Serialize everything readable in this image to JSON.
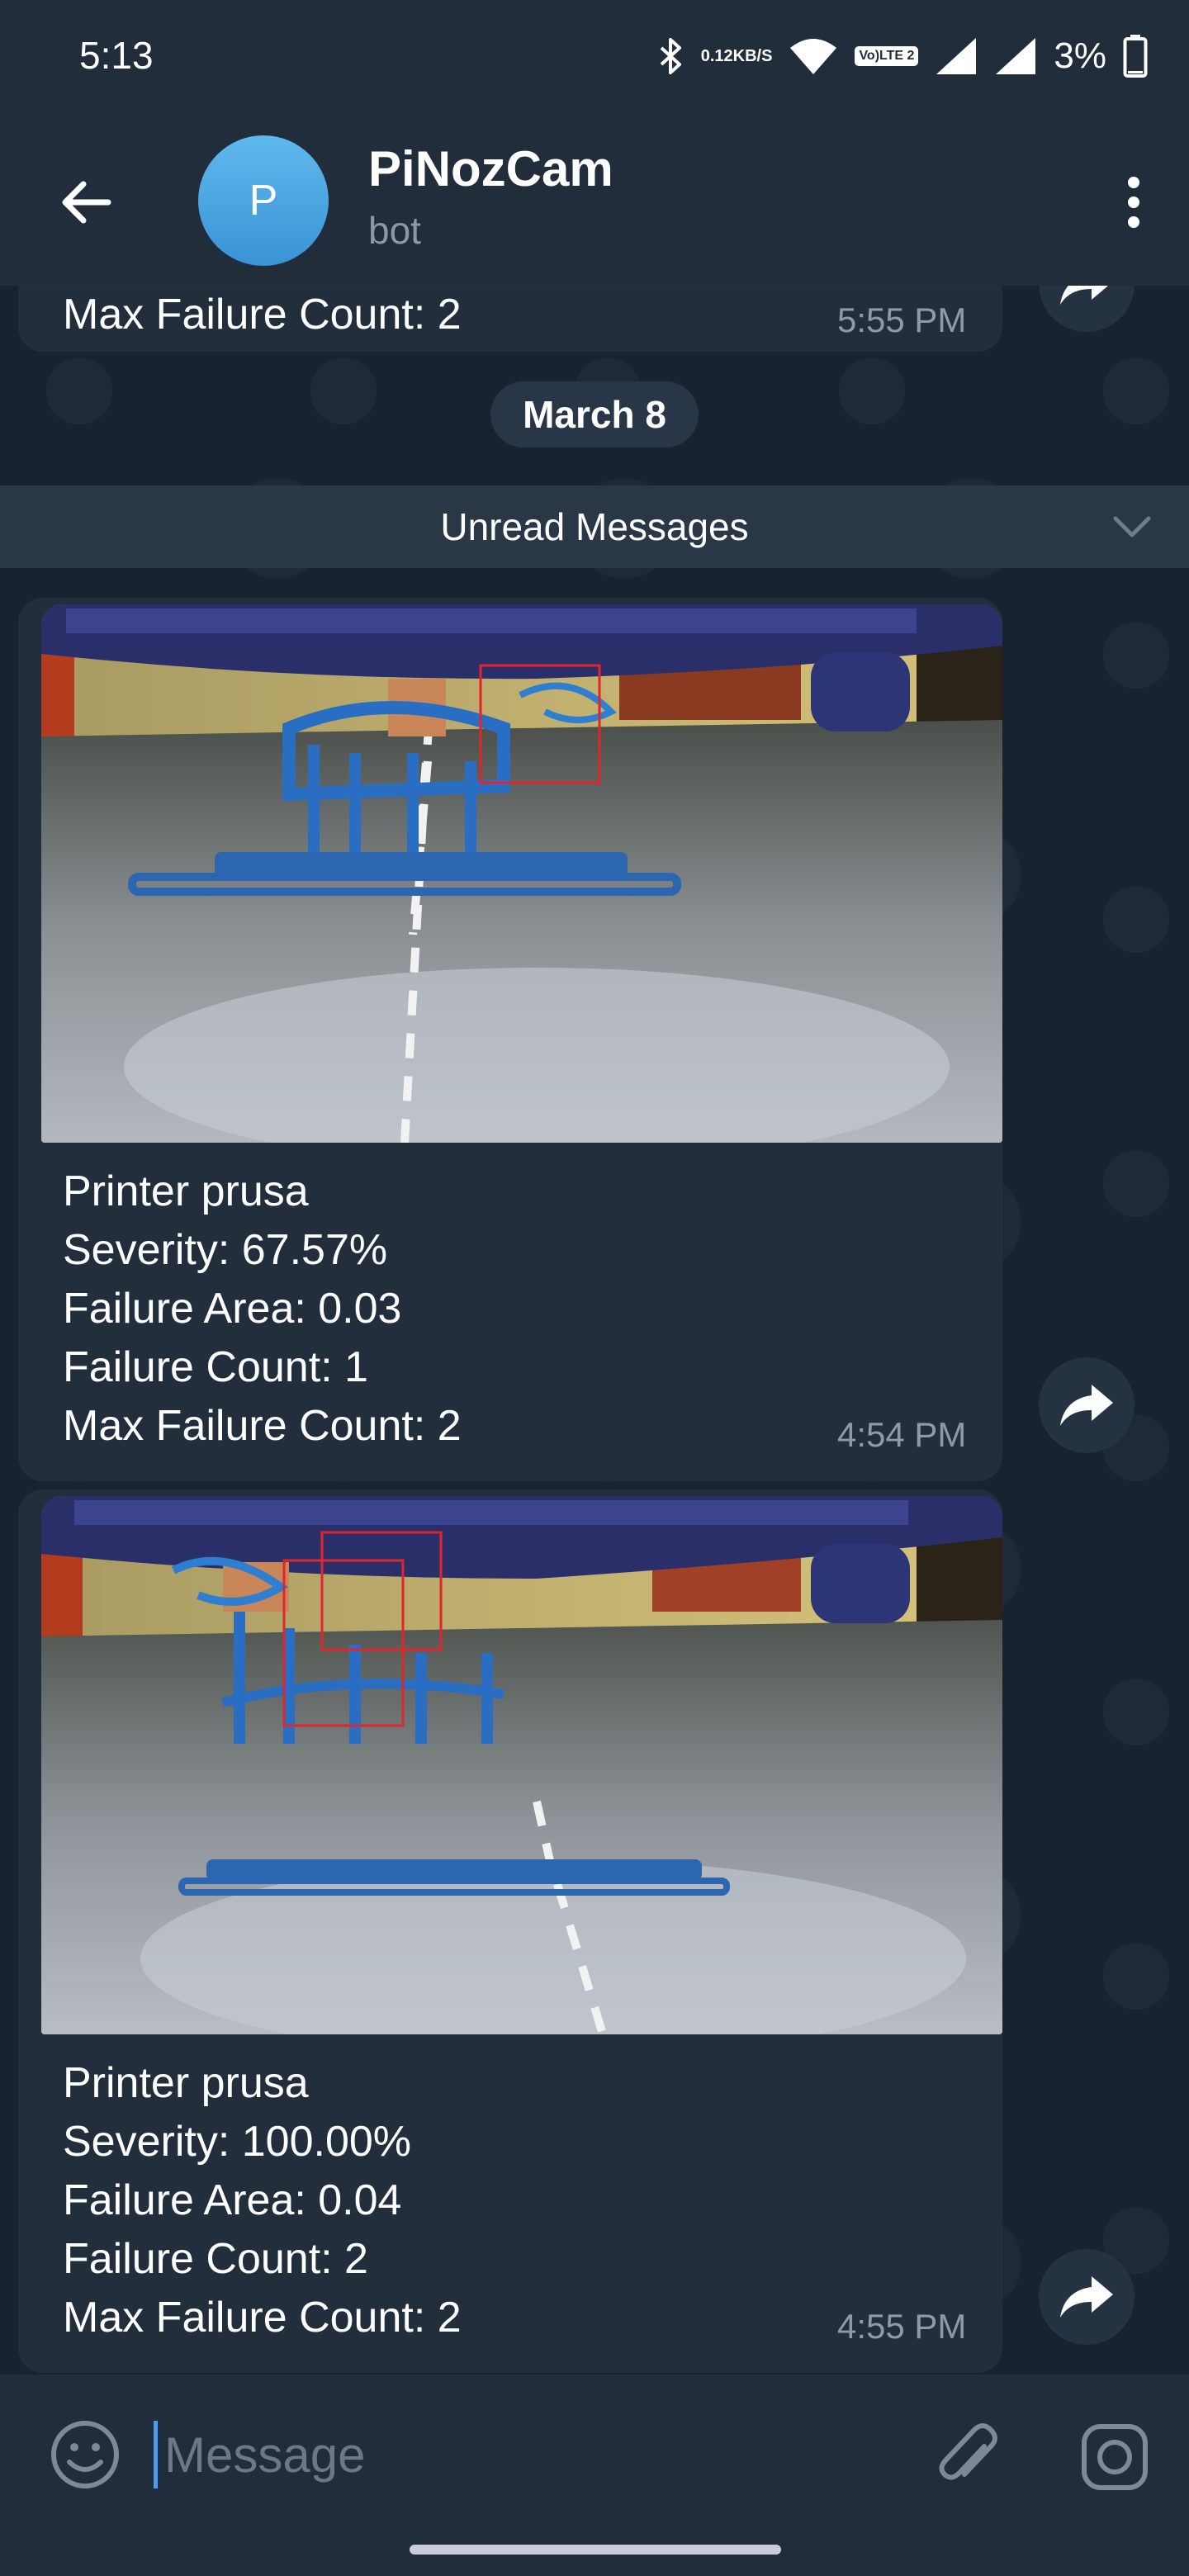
{
  "status_bar": {
    "time": "5:13",
    "net_speed_value": "0.12",
    "net_speed_unit": "KB/S",
    "volte_top": "Vo)",
    "volte_bottom": "LTE 2",
    "battery_percent": "3%",
    "icons": [
      "bluetooth-icon",
      "wifi-icon",
      "signal-icon",
      "battery-icon"
    ]
  },
  "header": {
    "avatar_letter": "P",
    "title": "PiNozCam",
    "subtitle": "bot",
    "icons": [
      "back-arrow-icon",
      "more-vert-icon"
    ]
  },
  "chat": {
    "previous_message": {
      "last_line": "Max Failure Count: 2",
      "time": "5:55 PM"
    },
    "date_separator": "March 8",
    "unread_label": "Unread Messages",
    "messages": [
      {
        "image": "printer-camera-photo",
        "lines": [
          "Printer prusa",
          "Severity: 67.57%",
          "Failure Area: 0.03",
          "Failure Count: 1",
          "Max Failure Count: 2"
        ],
        "time": "4:54 PM"
      },
      {
        "image": "printer-camera-photo",
        "lines": [
          "Printer prusa",
          "Severity: 100.00%",
          "Failure Area: 0.04",
          "Failure Count: 2",
          "Max Failure Count: 2"
        ],
        "time": "4:55 PM"
      }
    ]
  },
  "composer": {
    "placeholder": "Message",
    "icons": [
      "emoji-icon",
      "paperclip-icon",
      "camera-icon"
    ]
  },
  "colors": {
    "header_bg": "#222d3b",
    "chat_bg": "#182330",
    "bubble_bg": "#222e3c",
    "accent": "#4a9df0",
    "timestamp": "#8d9aaa",
    "detection_box": "#e0252b"
  }
}
